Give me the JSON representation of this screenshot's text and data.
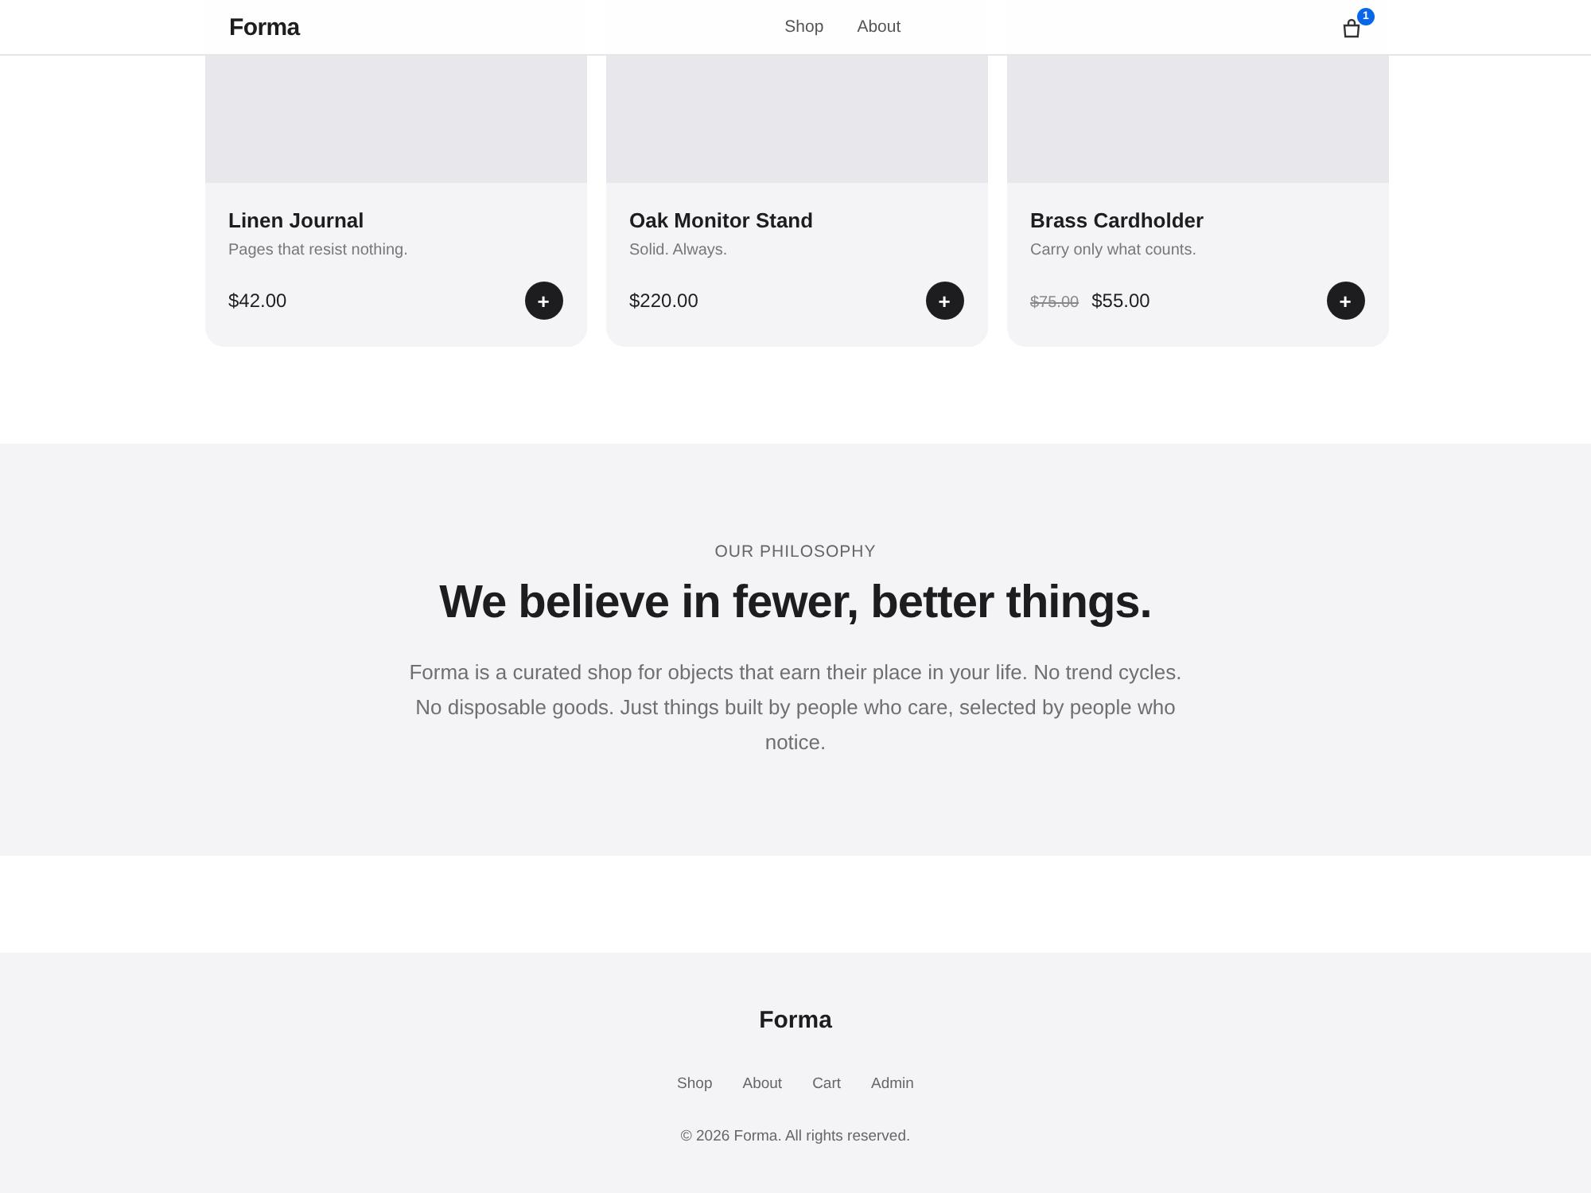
{
  "header": {
    "logo": "Forma",
    "nav": [
      {
        "label": "Shop"
      },
      {
        "label": "About"
      }
    ],
    "cart_count": "1"
  },
  "products": [
    {
      "name": "Linen Journal",
      "tagline": "Pages that resist nothing.",
      "price": "$42.00",
      "add": "+"
    },
    {
      "name": "Oak Monitor Stand",
      "tagline": "Solid. Always.",
      "price": "$220.00",
      "add": "+"
    },
    {
      "name": "Brass Cardholder",
      "tagline": "Carry only what counts.",
      "old_price": "$75.00",
      "price": "$55.00",
      "add": "+"
    }
  ],
  "philosophy": {
    "eyebrow": "OUR PHILOSOPHY",
    "heading": "We believe in fewer, better things.",
    "body": "Forma is a curated shop for objects that earn their place in your life. No trend cycles. No disposable goods. Just things built by people who care, selected by people who notice."
  },
  "footer": {
    "logo": "Forma",
    "links": [
      {
        "label": "Shop"
      },
      {
        "label": "About"
      },
      {
        "label": "Cart"
      },
      {
        "label": "Admin"
      }
    ],
    "copyright": "© 2026 Forma. All rights reserved."
  }
}
